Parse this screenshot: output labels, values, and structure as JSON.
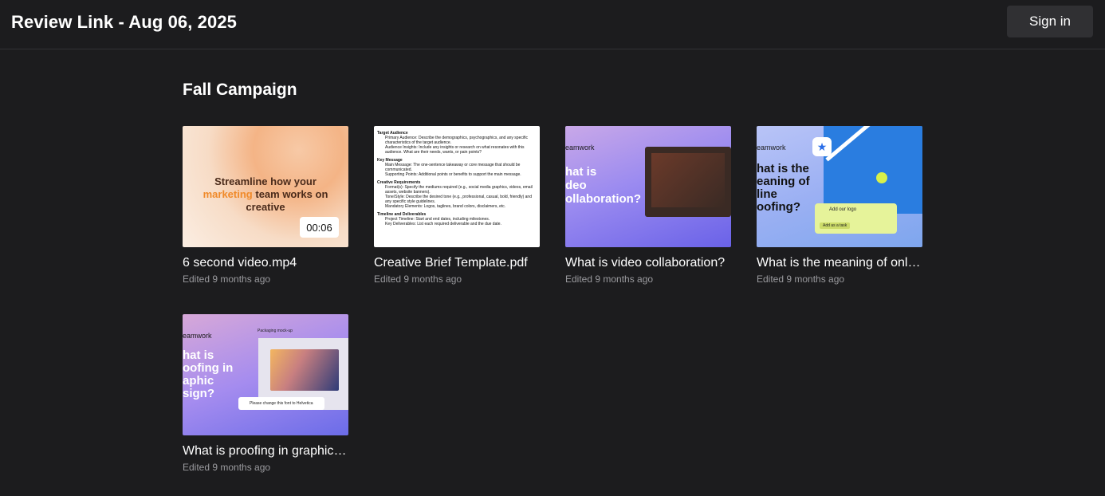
{
  "header": {
    "title": "Review Link - Aug 06, 2025",
    "sign_in": "Sign in"
  },
  "section": {
    "title": "Fall Campaign"
  },
  "items": [
    {
      "name": "6 second video.mp4",
      "edited": "Edited 9 months ago",
      "duration": "00:06",
      "thumb_text_1": "Streamline how your",
      "thumb_text_hl": "marketing",
      "thumb_text_2": "team works on creative"
    },
    {
      "name": "Creative Brief Template.pdf",
      "edited": "Edited 9 months ago",
      "doc": {
        "h1": "Target Audience",
        "l1": "Primary Audience: Describe the demographics, psychographics, and any specific characteristics of the target audience.",
        "l2": "Audience Insights: Include any insights or research on what resonates with this audience. What are their needs, wants, or pain points?",
        "h2": "Key Message",
        "l3": "Main Message: The one-sentence takeaway or core message that should be communicated.",
        "l4": "Supporting Points: Additional points or benefits to support the main message.",
        "h3": "Creative Requirements",
        "l5": "Format(s): Specify the mediums required (e.g., social media graphics, videos, email assets, website banners).",
        "l6": "Tone/Style: Describe the desired tone (e.g., professional, casual, bold, friendly) and any specific style guidelines.",
        "l7": "Mandatory Elements: Logos, taglines, brand colors, disclaimers, etc.",
        "h4": "Timeline and Deliverables",
        "l8": "Project Timeline: Start and end dates, including milestones.",
        "l9": "Key Deliverables: List each required deliverable and the due date."
      }
    },
    {
      "name": "What is video collaboration?",
      "edited": "Edited 9 months ago",
      "logo": "eamwork",
      "thumb_lines": [
        "hat is",
        "deo",
        "ollaboration?"
      ]
    },
    {
      "name": "What is the meaning of online proofing?",
      "edited": "Edited 9 months ago",
      "logo": "eamwork",
      "thumb_lines": [
        "hat is the",
        "eaning of",
        "line",
        "oofing?"
      ],
      "card_text": "Add our logo",
      "card_button": "Add as a task"
    },
    {
      "name": "What is proofing in graphic design?",
      "edited": "Edited 9 months ago",
      "logo": "eamwork",
      "thumb_lines": [
        "hat is",
        "oofing in",
        "aphic",
        "sign?"
      ],
      "panel_label": "Packaging mock-up",
      "tip_text": "Please change this font to Helvetica"
    }
  ]
}
